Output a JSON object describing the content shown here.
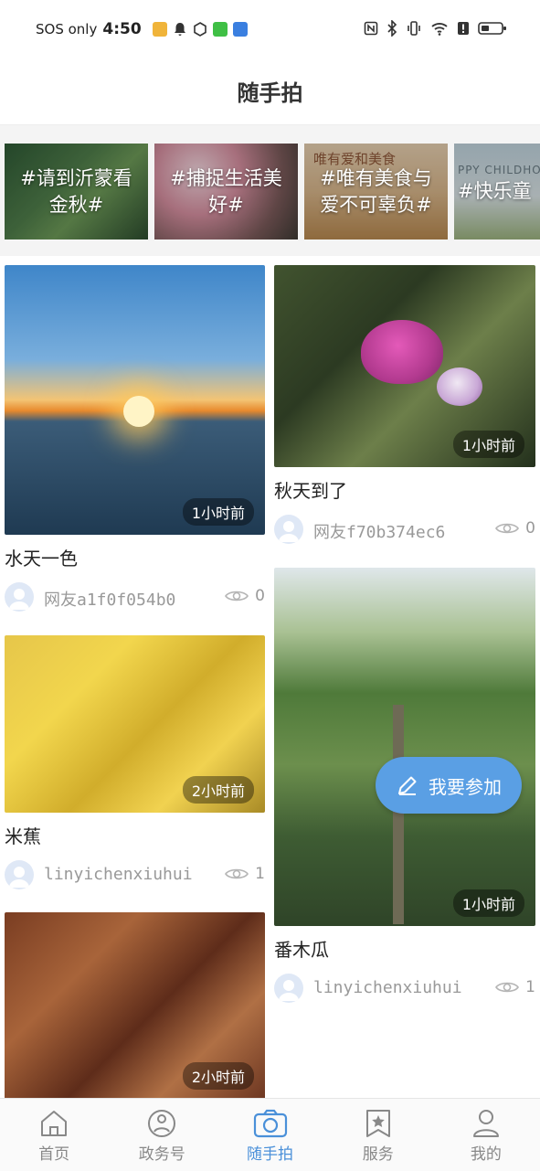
{
  "status_bar": {
    "carrier": "SOS only",
    "time": "4:50"
  },
  "header": {
    "title": "随手拍"
  },
  "topics": [
    {
      "label": "#请到沂蒙看金秋#"
    },
    {
      "label": "#捕捉生活美好#"
    },
    {
      "label": "#唯有美食与爱不可辜负#"
    },
    {
      "label": "#快乐童"
    }
  ],
  "topic_bg_text": {
    "banner3": "唯有爱和美食",
    "banner4": "PPY CHILDHO"
  },
  "posts": [
    {
      "title": "水天一色",
      "time": "1小时前",
      "author": "网友a1f0f054b0",
      "views": "0"
    },
    {
      "title": "秋天到了",
      "time": "1小时前",
      "author": "网友f70b374ec6",
      "views": "0"
    },
    {
      "title": "米蕉",
      "time": "2小时前",
      "author": "linyichenxiuhui",
      "views": "1"
    },
    {
      "title": "番木瓜",
      "time": "1小时前",
      "author": "linyichenxiuhui",
      "views": "1"
    },
    {
      "title": "",
      "time": "2小时前",
      "author": "",
      "views": ""
    }
  ],
  "fab": {
    "label": "我要参加"
  },
  "tabs": [
    {
      "label": "首页",
      "icon": "home-icon"
    },
    {
      "label": "政务号",
      "icon": "government-icon"
    },
    {
      "label": "随手拍",
      "icon": "camera-icon"
    },
    {
      "label": "服务",
      "icon": "service-star-icon"
    },
    {
      "label": "我的",
      "icon": "profile-icon"
    }
  ],
  "colors": {
    "accent": "#4a90d9",
    "fab": "#5a9fe4",
    "muted": "#999999"
  }
}
